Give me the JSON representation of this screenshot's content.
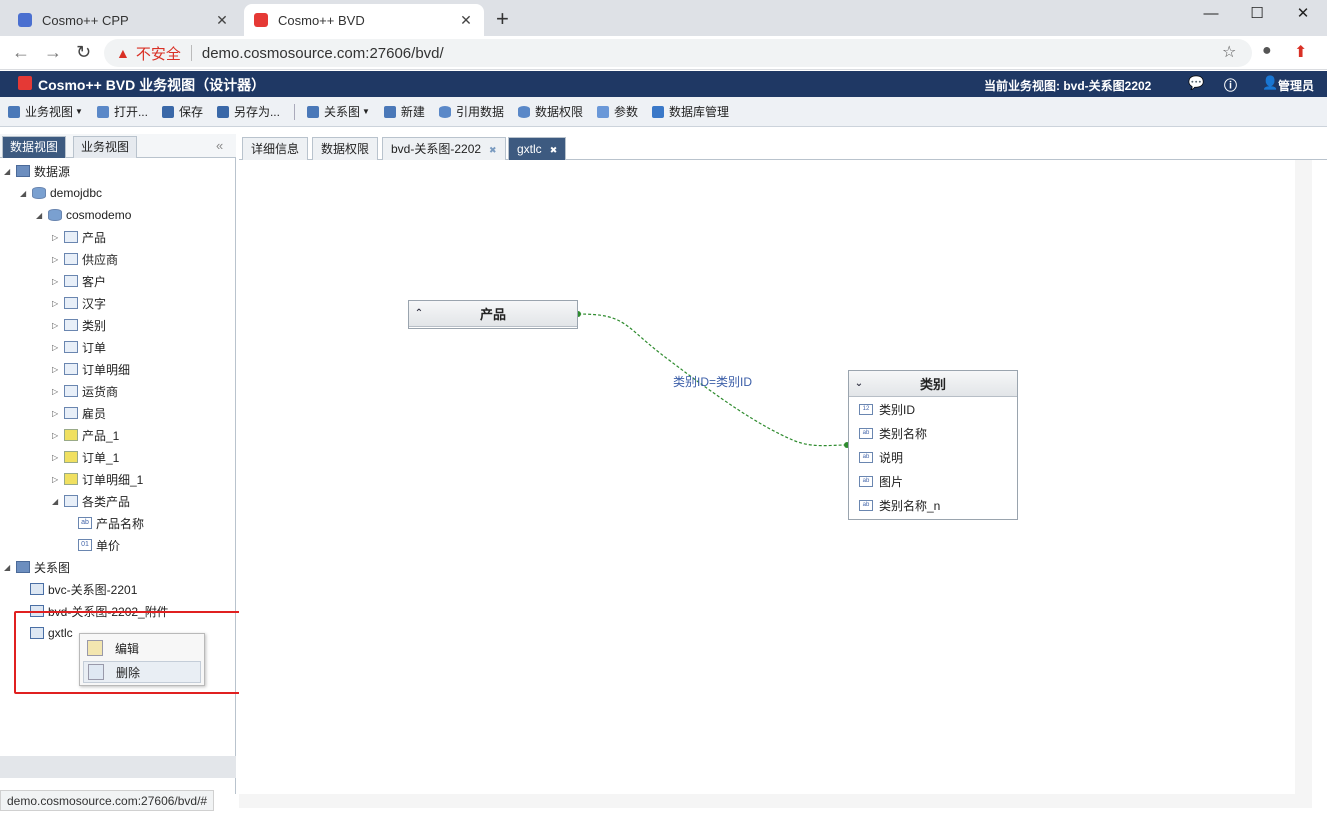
{
  "browser": {
    "tabs": [
      {
        "title": "Cosmo++ CPP",
        "active": false,
        "favicon_color": "#4a6fd0"
      },
      {
        "title": "Cosmo++ BVD",
        "active": true,
        "favicon_color": "#e53935"
      }
    ],
    "new_tab": "+",
    "insecure_label": "不安全",
    "url": "demo.cosmosource.com:27606/bvd/",
    "status_url": "demo.cosmosource.com:27606/bvd/#"
  },
  "app": {
    "title": "Cosmo++ BVD 业务视图（设计器）",
    "current_view": "当前业务视图: bvd-关系图2202",
    "user": "管理员",
    "brand_color": "#1f3864"
  },
  "toolbar": {
    "items": [
      {
        "label": "业务视图",
        "dropdown": true,
        "icon": "view-icon"
      },
      {
        "label": "打开...",
        "icon": "folder-open-icon"
      },
      {
        "label": "保存",
        "icon": "save-icon"
      },
      {
        "label": "另存为...",
        "icon": "save-as-icon"
      },
      {
        "label": "关系图",
        "dropdown": true,
        "icon": "diagram-icon"
      },
      {
        "label": "新建",
        "icon": "new-icon"
      },
      {
        "label": "引用数据",
        "icon": "database-icon"
      },
      {
        "label": "数据权限",
        "icon": "permission-icon"
      },
      {
        "label": "参数",
        "icon": "parameter-icon"
      },
      {
        "label": "数据库管理",
        "icon": "db-manage-icon"
      }
    ]
  },
  "left_tabs": [
    "数据视图",
    "业务视图"
  ],
  "tree": {
    "datasource": "数据源",
    "connection": "demojdbc",
    "schema": "cosmodemo",
    "tables": [
      "产品",
      "供应商",
      "客户",
      "汉字",
      "类别",
      "订单",
      "订单明细",
      "运货商",
      "雇员"
    ],
    "views": [
      "产品_1",
      "订单_1",
      "订单明细_1"
    ],
    "query": "各类产品",
    "query_columns": [
      {
        "name": "产品名称",
        "type": "ab"
      },
      {
        "name": "单价",
        "type": "01"
      }
    ],
    "relations_root": "关系图",
    "relations": [
      "bvc-关系图-2201",
      "bvd-关系图-2202_附件",
      "gxtlc"
    ]
  },
  "context_menu": {
    "items": [
      "编辑",
      "删除"
    ]
  },
  "main_tabs": [
    {
      "label": "详细信息",
      "closable": false
    },
    {
      "label": "数据权限",
      "closable": false
    },
    {
      "label": "bvd-关系图-2202",
      "closable": true
    },
    {
      "label": "gxtlc",
      "closable": true,
      "active": true
    }
  ],
  "diagram": {
    "entities": [
      {
        "name": "产品",
        "collapsed": true,
        "fields": []
      },
      {
        "name": "类别",
        "collapsed": false,
        "fields": [
          {
            "name": "类别ID",
            "type": "12"
          },
          {
            "name": "类别名称",
            "type": "ab"
          },
          {
            "name": "说明",
            "type": "ab"
          },
          {
            "name": "图片",
            "type": "ab"
          },
          {
            "name": "类别名称_n",
            "type": "ab"
          }
        ]
      }
    ],
    "relation_label": "类别ID=类别ID",
    "relation_color": "#2e8b2e"
  }
}
